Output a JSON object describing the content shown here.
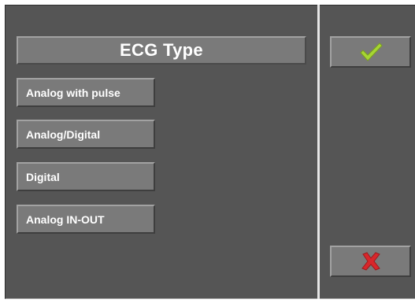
{
  "dialog": {
    "title": "ECG Type",
    "options": [
      {
        "label": "Analog with pulse"
      },
      {
        "label": "Analog/Digital"
      },
      {
        "label": "Digital"
      },
      {
        "label": "Analog IN-OUT"
      }
    ]
  },
  "actions": {
    "confirm_icon": "checkmark-icon",
    "cancel_icon": "cross-icon"
  },
  "colors": {
    "panel": "#555555",
    "button": "#7a7a7a",
    "confirm_accent": "#a6d633",
    "cancel_accent": "#d8262b",
    "text": "#ffffff"
  }
}
